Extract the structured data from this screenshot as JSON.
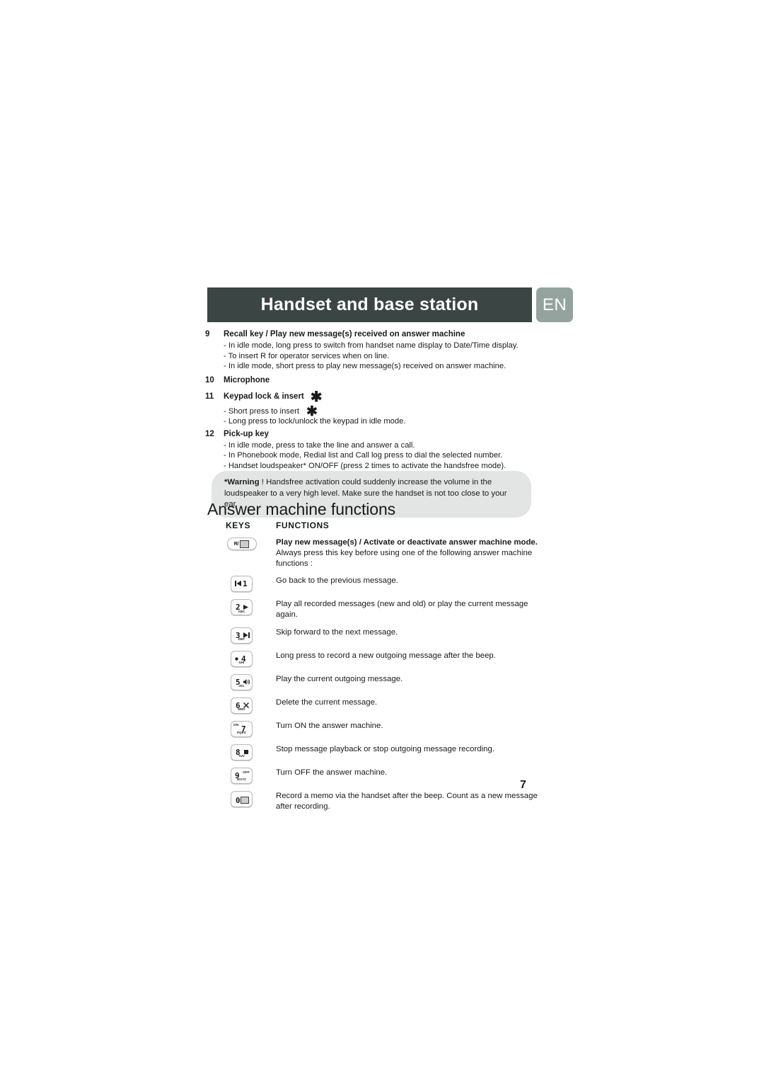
{
  "header": {
    "title": "Handset and base station",
    "lang_badge": "EN",
    "bar_color": "#3b4543",
    "badge_color": "#94a39e"
  },
  "numbered_items": [
    {
      "index": "9",
      "title": "Recall key / Play new message(s) received on answer machine",
      "star_after_title": false,
      "lines": [
        "- In idle mode, long press to switch from handset name display to Date/Time display.",
        "- To insert R for operator services when on line.",
        "- In idle mode, short press to play new message(s) received on answer machine."
      ]
    },
    {
      "index": "10",
      "title": "Microphone",
      "star_after_title": false,
      "lines": []
    },
    {
      "index": "11",
      "title": "Keypad lock & insert",
      "star_after_title": true,
      "lines": [
        "- Short press to insert",
        "- Long press to lock/unlock the keypad in idle mode."
      ],
      "star_after_first_line": true
    },
    {
      "index": "12",
      "title": "Pick-up key",
      "star_after_title": false,
      "lines": [
        "- In idle mode, press to take the line and answer a call.",
        "- In Phonebook mode, Redial list and Call log press to dial the selected number.",
        "- Handset loudspeaker* ON/OFF (press 2 times to activate the handsfree mode)."
      ]
    }
  ],
  "warning": {
    "label": "*Warning",
    "text": " ! Handsfree activation could suddenly increase the volume in the loudspeaker to a very high level. Make sure the handset is not too close to your ear.",
    "background": "#e3e5e4"
  },
  "section": {
    "title": "Answer machine functions"
  },
  "table": {
    "headers": {
      "keys": "KEYS",
      "functions": "FUNCTIONS"
    },
    "rows": [
      {
        "key_digit": "R/",
        "key_sub": "",
        "key_top": "",
        "key_type": "pill",
        "key_icon": "recall-answermachine-icon",
        "function_bold": "Play new message(s) / Activate or deactivate answer machine mode.",
        "function_text": " Always press this key before using one of the following answer machine functions :"
      },
      {
        "key_digit": "1",
        "key_sub": "",
        "key_top": "",
        "key_type": "square",
        "key_icon": "previous-track-icon",
        "function_bold": "",
        "function_text": "Go back to the previous message."
      },
      {
        "key_digit": "2",
        "key_sub": "ABC",
        "key_top": "",
        "key_type": "square",
        "key_icon": "play-icon",
        "function_bold": "",
        "function_text": "Play all recorded messages (new and old) or play the current message again."
      },
      {
        "key_digit": "3",
        "key_sub": "DEF",
        "key_top": "",
        "key_type": "square",
        "key_icon": "next-track-icon",
        "function_bold": "",
        "function_text": "Skip forward to the next message."
      },
      {
        "key_digit": "4",
        "key_sub": "GHI",
        "key_top": "",
        "key_type": "square",
        "key_icon": "record-dot-icon",
        "function_bold": "",
        "function_text": "Long press to record a new outgoing message after the beep."
      },
      {
        "key_digit": "5",
        "key_sub": "JKL",
        "key_top": "",
        "key_type": "square",
        "key_icon": "outgoing-message-icon",
        "function_bold": "",
        "function_text": "Play the current outgoing message."
      },
      {
        "key_digit": "6",
        "key_sub": "MNO",
        "key_top": "",
        "key_type": "square",
        "key_icon": "delete-cross-icon",
        "function_bold": "",
        "function_text": "Delete the current message."
      },
      {
        "key_digit": "7",
        "key_sub": "PQRS",
        "key_top": "ON",
        "key_type": "square",
        "key_icon": "power-on-icon",
        "function_bold": "",
        "function_text": "Turn ON the answer machine."
      },
      {
        "key_digit": "8",
        "key_sub": "TUV",
        "key_top": "",
        "key_type": "square",
        "key_icon": "stop-square-icon",
        "function_bold": "",
        "function_text": "Stop message playback or stop outgoing message recording."
      },
      {
        "key_digit": "9",
        "key_sub": "WXYZ",
        "key_top": "OFF",
        "key_type": "square",
        "key_icon": "power-off-icon",
        "function_bold": "",
        "function_text": "Turn OFF the answer machine."
      },
      {
        "key_digit": "0",
        "key_sub": "",
        "key_top": "",
        "key_type": "square",
        "key_icon": "memo-record-icon",
        "function_bold": "",
        "function_text": "Record a memo via the handset after the beep. Count as a new message after recording."
      }
    ]
  },
  "footer": {
    "page_number": "7"
  }
}
